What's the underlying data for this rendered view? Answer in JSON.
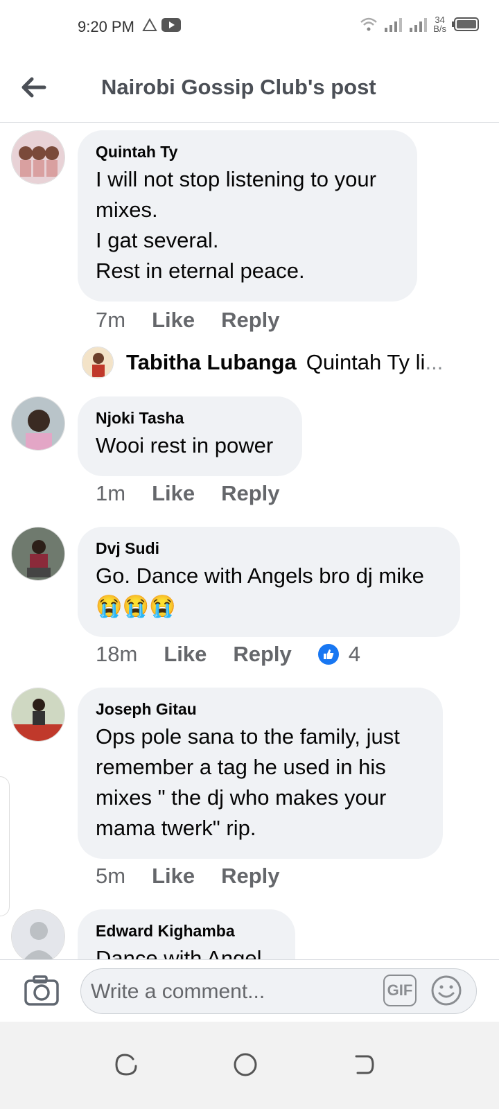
{
  "status_bar": {
    "time": "9:20 PM",
    "net_speed_value": "34",
    "net_speed_unit": "B/s"
  },
  "header": {
    "title": "Nairobi Gossip Club's post"
  },
  "comments": [
    {
      "author": "Quintah Ty",
      "text": "I will not stop listening to your mixes.\nI gat several.\nRest in eternal peace.",
      "time": "7m",
      "like_label": "Like",
      "reply_label": "Reply"
    },
    {
      "author": "Njoki Tasha",
      "text": "Wooi rest in power",
      "time": "1m",
      "like_label": "Like",
      "reply_label": "Reply"
    },
    {
      "author": "Dvj Sudi",
      "text": "Go. Dance with Angels bro dj mike",
      "emoji": "😭😭😭",
      "time": "18m",
      "like_label": "Like",
      "reply_label": "Reply",
      "reaction_count": "4"
    },
    {
      "author": "Joseph Gitau",
      "text": "Ops pole sana to the family,  just remember a tag he used in his mixes \" the dj who makes your mama twerk\" rip.",
      "time": "5m",
      "like_label": "Like",
      "reply_label": "Reply"
    },
    {
      "author": "Edward Kighamba",
      "text": "Dance with Angel"
    }
  ],
  "reply_preview": {
    "name": "Tabitha Lubanga",
    "snippet": "Quintah Ty li",
    "ellipsis": "..."
  },
  "composer": {
    "placeholder": "Write a comment...",
    "gif_label": "GIF"
  },
  "colors": {
    "accent": "#1877f2",
    "bubble": "#f0f2f5",
    "meta_text": "#65676b"
  }
}
